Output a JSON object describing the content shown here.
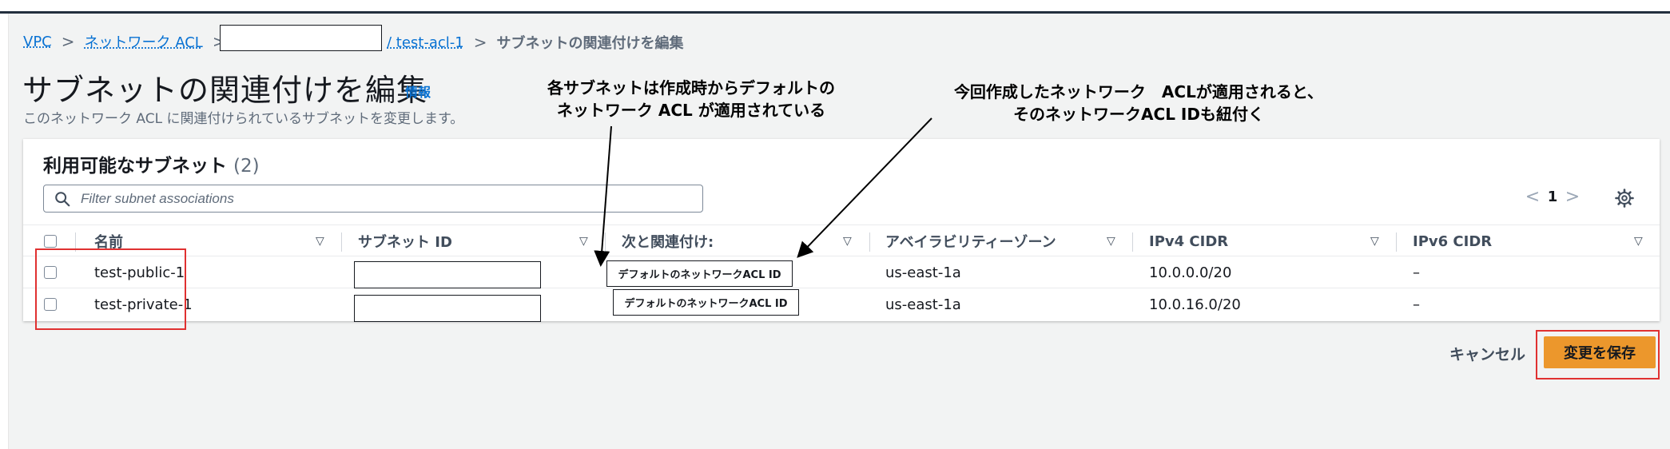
{
  "breadcrumb": {
    "vpc": "VPC",
    "network_acl": "ネットワーク ACL",
    "acl_name": "/ test-acl-1",
    "current": "サブネットの関連付けを編集",
    "separator": ">"
  },
  "header": {
    "title": "サブネットの関連付けを編集",
    "info_link": "情報",
    "description": "このネットワーク ACL に関連付けられているサブネットを変更します。"
  },
  "annotations": {
    "default_acl": "各サブネットは作成時からデフォルトの\nネットワーク ACL が適用されている",
    "new_acl": "今回作成したネットワーク　ACLが適用されると、\nそのネットワークACL IDも紐付く"
  },
  "panel": {
    "title": "利用可能なサブネット",
    "count": "(2)",
    "search_placeholder": "Filter subnet associations",
    "page_prev": "<",
    "page_number": "1",
    "page_next": ">"
  },
  "table": {
    "sort_icon": "▽",
    "columns": [
      "名前",
      "サブネット ID",
      "次と関連付け:",
      "アベイラビリティーゾーン",
      "IPv4 CIDR",
      "IPv6 CIDR"
    ],
    "rows": [
      {
        "name": "test-public-1",
        "associated": "デフォルトのネットワークACL ID",
        "az": "us-east-1a",
        "ipv4": "10.0.0.0/20",
        "ipv6": "–"
      },
      {
        "name": "test-private-1",
        "associated": "デフォルトのネットワークACL ID",
        "az": "us-east-1a",
        "ipv4": "10.0.16.0/20",
        "ipv6": "–"
      }
    ]
  },
  "footer": {
    "cancel": "キャンセル",
    "save": "変更を保存"
  },
  "colors": {
    "primary_button": "#ec972c",
    "link": "#0972d3",
    "highlight": "#e03131"
  }
}
